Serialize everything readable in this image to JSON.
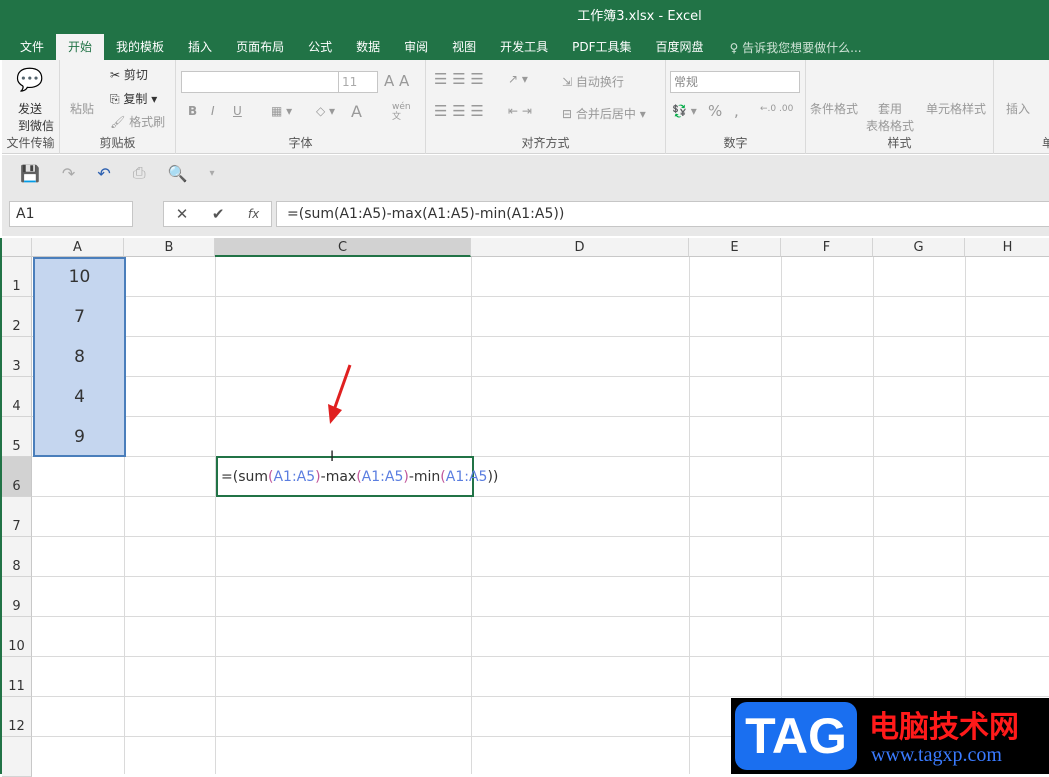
{
  "window": {
    "title": "工作簿3.xlsx - Excel"
  },
  "tabs": [
    "文件",
    "开始",
    "我的模板",
    "插入",
    "页面布局",
    "公式",
    "数据",
    "审阅",
    "视图",
    "开发工具",
    "PDF工具集",
    "百度网盘"
  ],
  "active_tab": "开始",
  "tell_me": "告诉我您想要做什么...",
  "ribbon": {
    "wechat": {
      "label1": "发送",
      "label2": "到微信",
      "group": "文件传输"
    },
    "clipboard": {
      "paste": "粘贴",
      "cut": "剪切",
      "copy": "复制",
      "format_painter": "格式刷",
      "group": "剪贴板"
    },
    "font": {
      "name": "",
      "size": "11",
      "bold": "B",
      "italic": "I",
      "underline": "U",
      "font_color": "A",
      "phonetic": "wén\n文",
      "group": "字体"
    },
    "alignment": {
      "wrap": "自动换行",
      "merge": "合并后居中",
      "group": "对齐方式"
    },
    "number": {
      "format": "常规",
      "percent": "%",
      "comma": ",",
      "group": "数字"
    },
    "styles": {
      "conditional": "条件格式",
      "table1": "套用",
      "table2": "表格格式",
      "cell_styles": "单元格样式",
      "group": "样式"
    },
    "cells": {
      "insert": "插入",
      "group": "单"
    }
  },
  "formula_bar": {
    "name_box": "A1",
    "fx": "fx",
    "formula": "=(sum(A1:A5)-max(A1:A5)-min(A1:A5))"
  },
  "columns": [
    "A",
    "B",
    "C",
    "D",
    "E",
    "F",
    "G",
    "H"
  ],
  "rows": [
    "1",
    "2",
    "3",
    "4",
    "5",
    "6",
    "7",
    "8",
    "9",
    "10",
    "11",
    "12"
  ],
  "cells": {
    "A1": "10",
    "A2": "7",
    "A3": "8",
    "A4": "4",
    "A5": "9"
  },
  "editing_cell": {
    "address": "C6",
    "parts": [
      "=(",
      "sum",
      "(",
      "A1:A5",
      ")",
      "-max",
      "(",
      "A1:A5",
      ")",
      "-min",
      "(",
      "A1:A5",
      "))"
    ]
  },
  "watermark": {
    "logo": "TAG",
    "name": "电脑技术网",
    "url": "www.tagxp.com"
  },
  "colors": {
    "accent": "#217346",
    "selection": "#c5d6ef",
    "annotation_arrow": "#e02020"
  }
}
